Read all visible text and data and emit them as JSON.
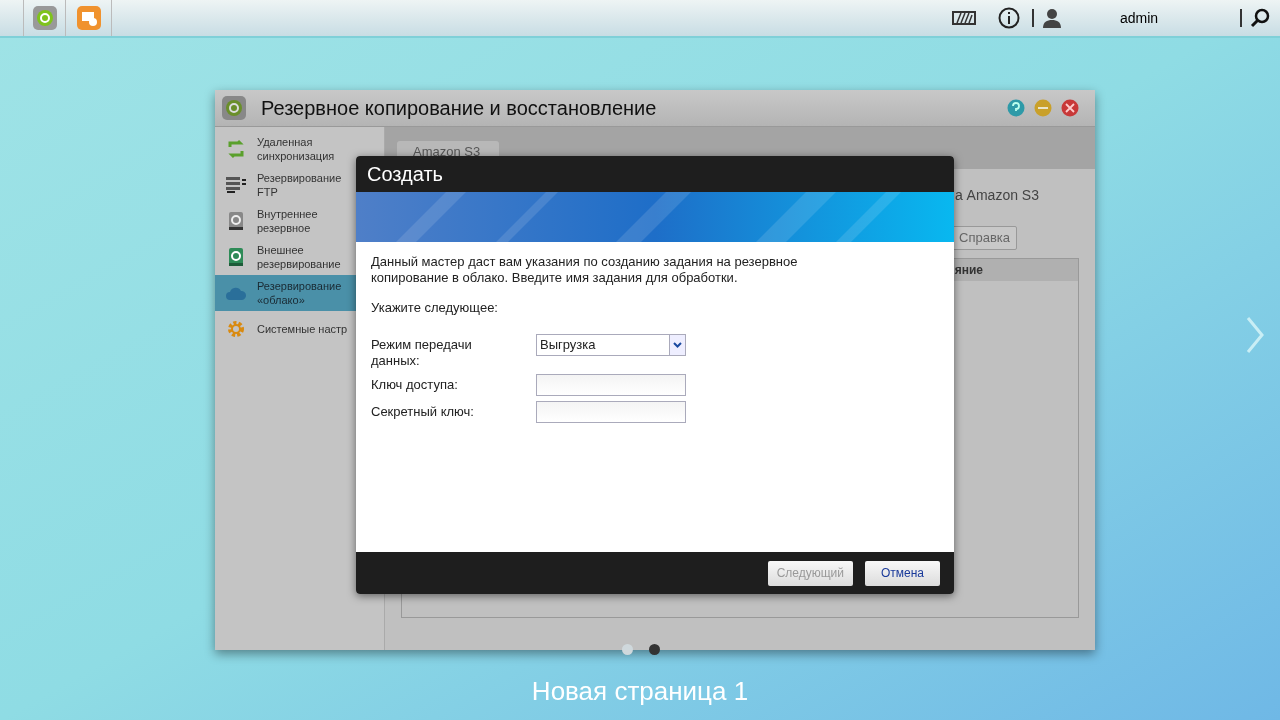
{
  "taskbar": {
    "user": "admin"
  },
  "window": {
    "title": "Резервное копирование и восстановление",
    "sidebar": [
      {
        "kind": "sync",
        "lines": [
          "Удаленная",
          "синхронизация"
        ],
        "selected": false
      },
      {
        "kind": "ftp",
        "lines": [
          "Резервирование",
          "FTP"
        ],
        "selected": false
      },
      {
        "kind": "internal",
        "lines": [
          "Внутреннее",
          "резервное"
        ],
        "selected": false
      },
      {
        "kind": "external",
        "lines": [
          "Внешнее",
          "резервирование"
        ],
        "selected": false
      },
      {
        "kind": "cloud",
        "lines": [
          "Резервирование",
          "«облако»"
        ],
        "selected": true
      },
      {
        "kind": "settings",
        "lines": [
          "Системные настр"
        ],
        "selected": false
      }
    ],
    "tab": "Amazon S3",
    "description": "а Amazon S3",
    "help_button": "Справка",
    "column_header": "яние"
  },
  "dialog": {
    "title": "Создать",
    "description": "Данный мастер даст вам указания по созданию задания на резервное копирование в облако. Введите имя задания для обработки.",
    "prompt": "Укажите следующее:",
    "fields": [
      {
        "kind": "select",
        "label": "Режим передачи данных:",
        "value": "Выгрузка"
      },
      {
        "kind": "text",
        "label": "Ключ доступа:"
      },
      {
        "kind": "text",
        "label": "Секретный ключ:"
      }
    ],
    "buttons": [
      {
        "label": "Следующий",
        "disabled": true
      },
      {
        "label": "Отмена",
        "disabled": false
      }
    ]
  },
  "pager": [
    {
      "selected": false
    },
    {
      "selected": true
    }
  ],
  "page_title": "Новая страница 1"
}
